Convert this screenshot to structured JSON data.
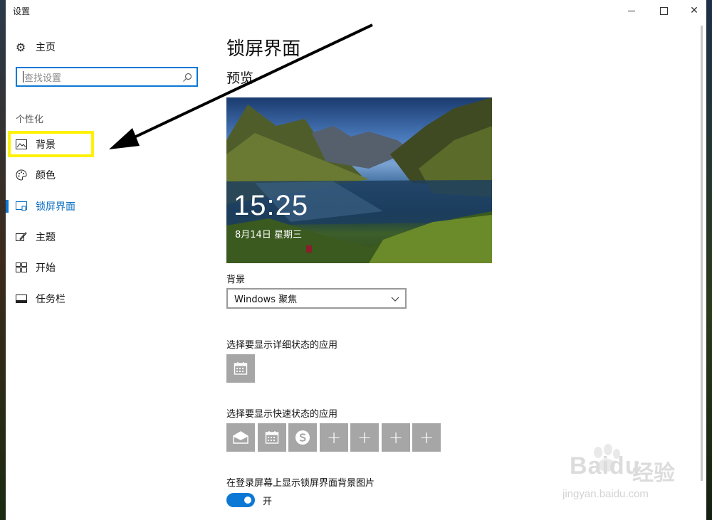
{
  "window": {
    "title": "设置"
  },
  "sidebar": {
    "home_label": "主页",
    "search_placeholder": "查找设置",
    "group_label": "个性化",
    "items": [
      {
        "label": "背景",
        "icon": "picture-icon"
      },
      {
        "label": "颜色",
        "icon": "palette-icon"
      },
      {
        "label": "锁屏界面",
        "icon": "lock-screen-icon",
        "active": true
      },
      {
        "label": "主题",
        "icon": "theme-icon"
      },
      {
        "label": "开始",
        "icon": "start-icon"
      },
      {
        "label": "任务栏",
        "icon": "taskbar-icon"
      }
    ]
  },
  "main": {
    "page_title": "锁屏界面",
    "preview_title": "预览",
    "preview": {
      "time": "15:25",
      "date": "8月14日 星期三"
    },
    "background_label": "背景",
    "background_value": "Windows 聚焦",
    "detailed_apps_label": "选择要显示详细状态的应用",
    "quick_apps_label": "选择要显示快速状态的应用",
    "quick_app_icons": [
      "mail-icon",
      "calendar-icon",
      "skype-icon",
      "plus-icon",
      "plus-icon",
      "plus-icon",
      "plus-icon"
    ],
    "show_bg_label": "在登录屏幕上显示锁屏界面背景图片",
    "toggle_state": "开"
  },
  "watermark": {
    "brand": "Bai",
    "brand2": "du",
    "cn": "经验",
    "url": "jingyan.baidu.com"
  },
  "colors": {
    "accent": "#0a78d4",
    "highlight": "#fff200",
    "tile": "#a6a6a6"
  }
}
